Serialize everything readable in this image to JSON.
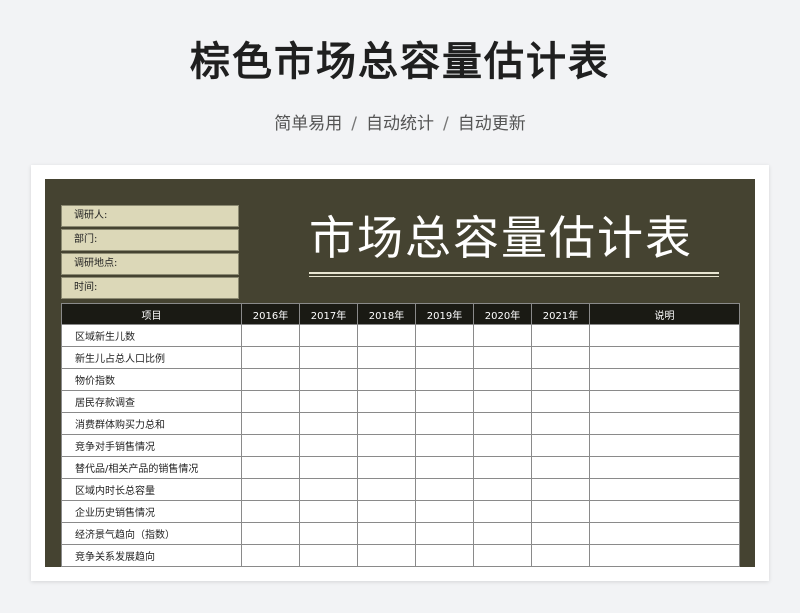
{
  "page": {
    "title": "棕色市场总容量估计表",
    "tags": [
      "简单易用",
      "自动统计",
      "自动更新"
    ],
    "separator": "/"
  },
  "sheet": {
    "title": "市场总容量估计表",
    "info_fields": [
      "调研人:",
      "部门:",
      "调研地点:",
      "时间:"
    ],
    "columns": [
      "项目",
      "2016年",
      "2017年",
      "2018年",
      "2019年",
      "2020年",
      "2021年",
      "说明"
    ],
    "rows": [
      "区域新生儿数",
      "新生儿占总人口比例",
      "物价指数",
      "居民存款调查",
      "消费群体购买力总和",
      "竞争对手销售情况",
      "替代品/相关产品的销售情况",
      "区域内时长总容量",
      "企业历史销售情况",
      "经济景气趋向（指数）",
      "竞争关系发展趋向"
    ]
  },
  "colors": {
    "sheet_background": "#454331",
    "info_cell": "#dcd8b8",
    "header_background": "#1a1a14"
  }
}
